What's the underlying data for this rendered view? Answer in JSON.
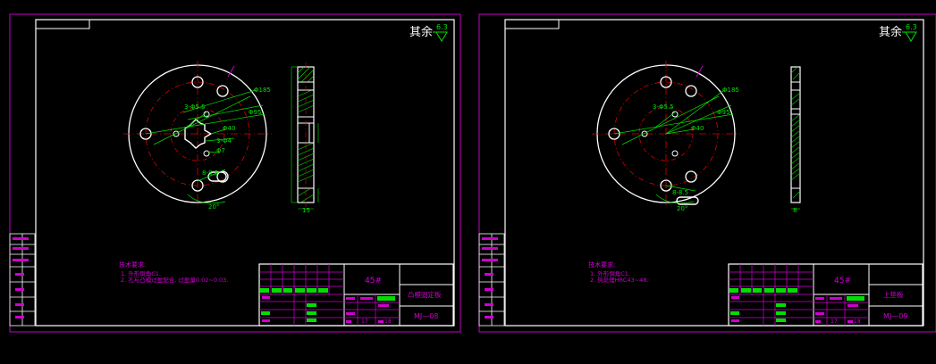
{
  "colors": {
    "background": "#000000",
    "sheet_border": "#c800c8",
    "frame": "#ffffff",
    "part_outline": "#ffffff",
    "center_line": "#e00000",
    "dimension": "#00e000",
    "title_block_fill": "#00e000"
  },
  "sheets": [
    {
      "surface_finish_label": "其余",
      "surface_finish_value": "6.3",
      "material": "45#",
      "part_name": "凸模固定板",
      "drawing_number": "MJ—08",
      "tech_req_title": "技术要求:",
      "tech_req_items": [
        "1. 外形倒角C1.",
        "2. 孔与凸模过盈配合, 过盈量0.02~0.03."
      ],
      "dims": {
        "bolt_holes": "3-Φ5.5",
        "pcd_large": "Φ185",
        "pcd_mid": "Φ95",
        "bore": "Φ40",
        "pins": "3-Φ4",
        "small": "Φ7",
        "slot": "8-8.5",
        "angle": "20°",
        "thickness": "15"
      },
      "scale_row": [
        "17",
        "18"
      ]
    },
    {
      "surface_finish_label": "其余",
      "surface_finish_value": "6.3",
      "material": "45#",
      "part_name": "上垫板",
      "drawing_number": "MJ—09",
      "tech_req_title": "技术要求:",
      "tech_req_items": [
        "1. 外形倒角C1.",
        "2. 热处理HRC43~48."
      ],
      "dims": {
        "bolt_holes": "3-Φ5.5",
        "pcd_large": "Φ185",
        "pcd_mid": "Φ95",
        "bore": "Φ40",
        "slot": "8-8.5",
        "angle": "20°",
        "thickness": "8"
      },
      "scale_row": [
        "17",
        "18"
      ]
    }
  ]
}
